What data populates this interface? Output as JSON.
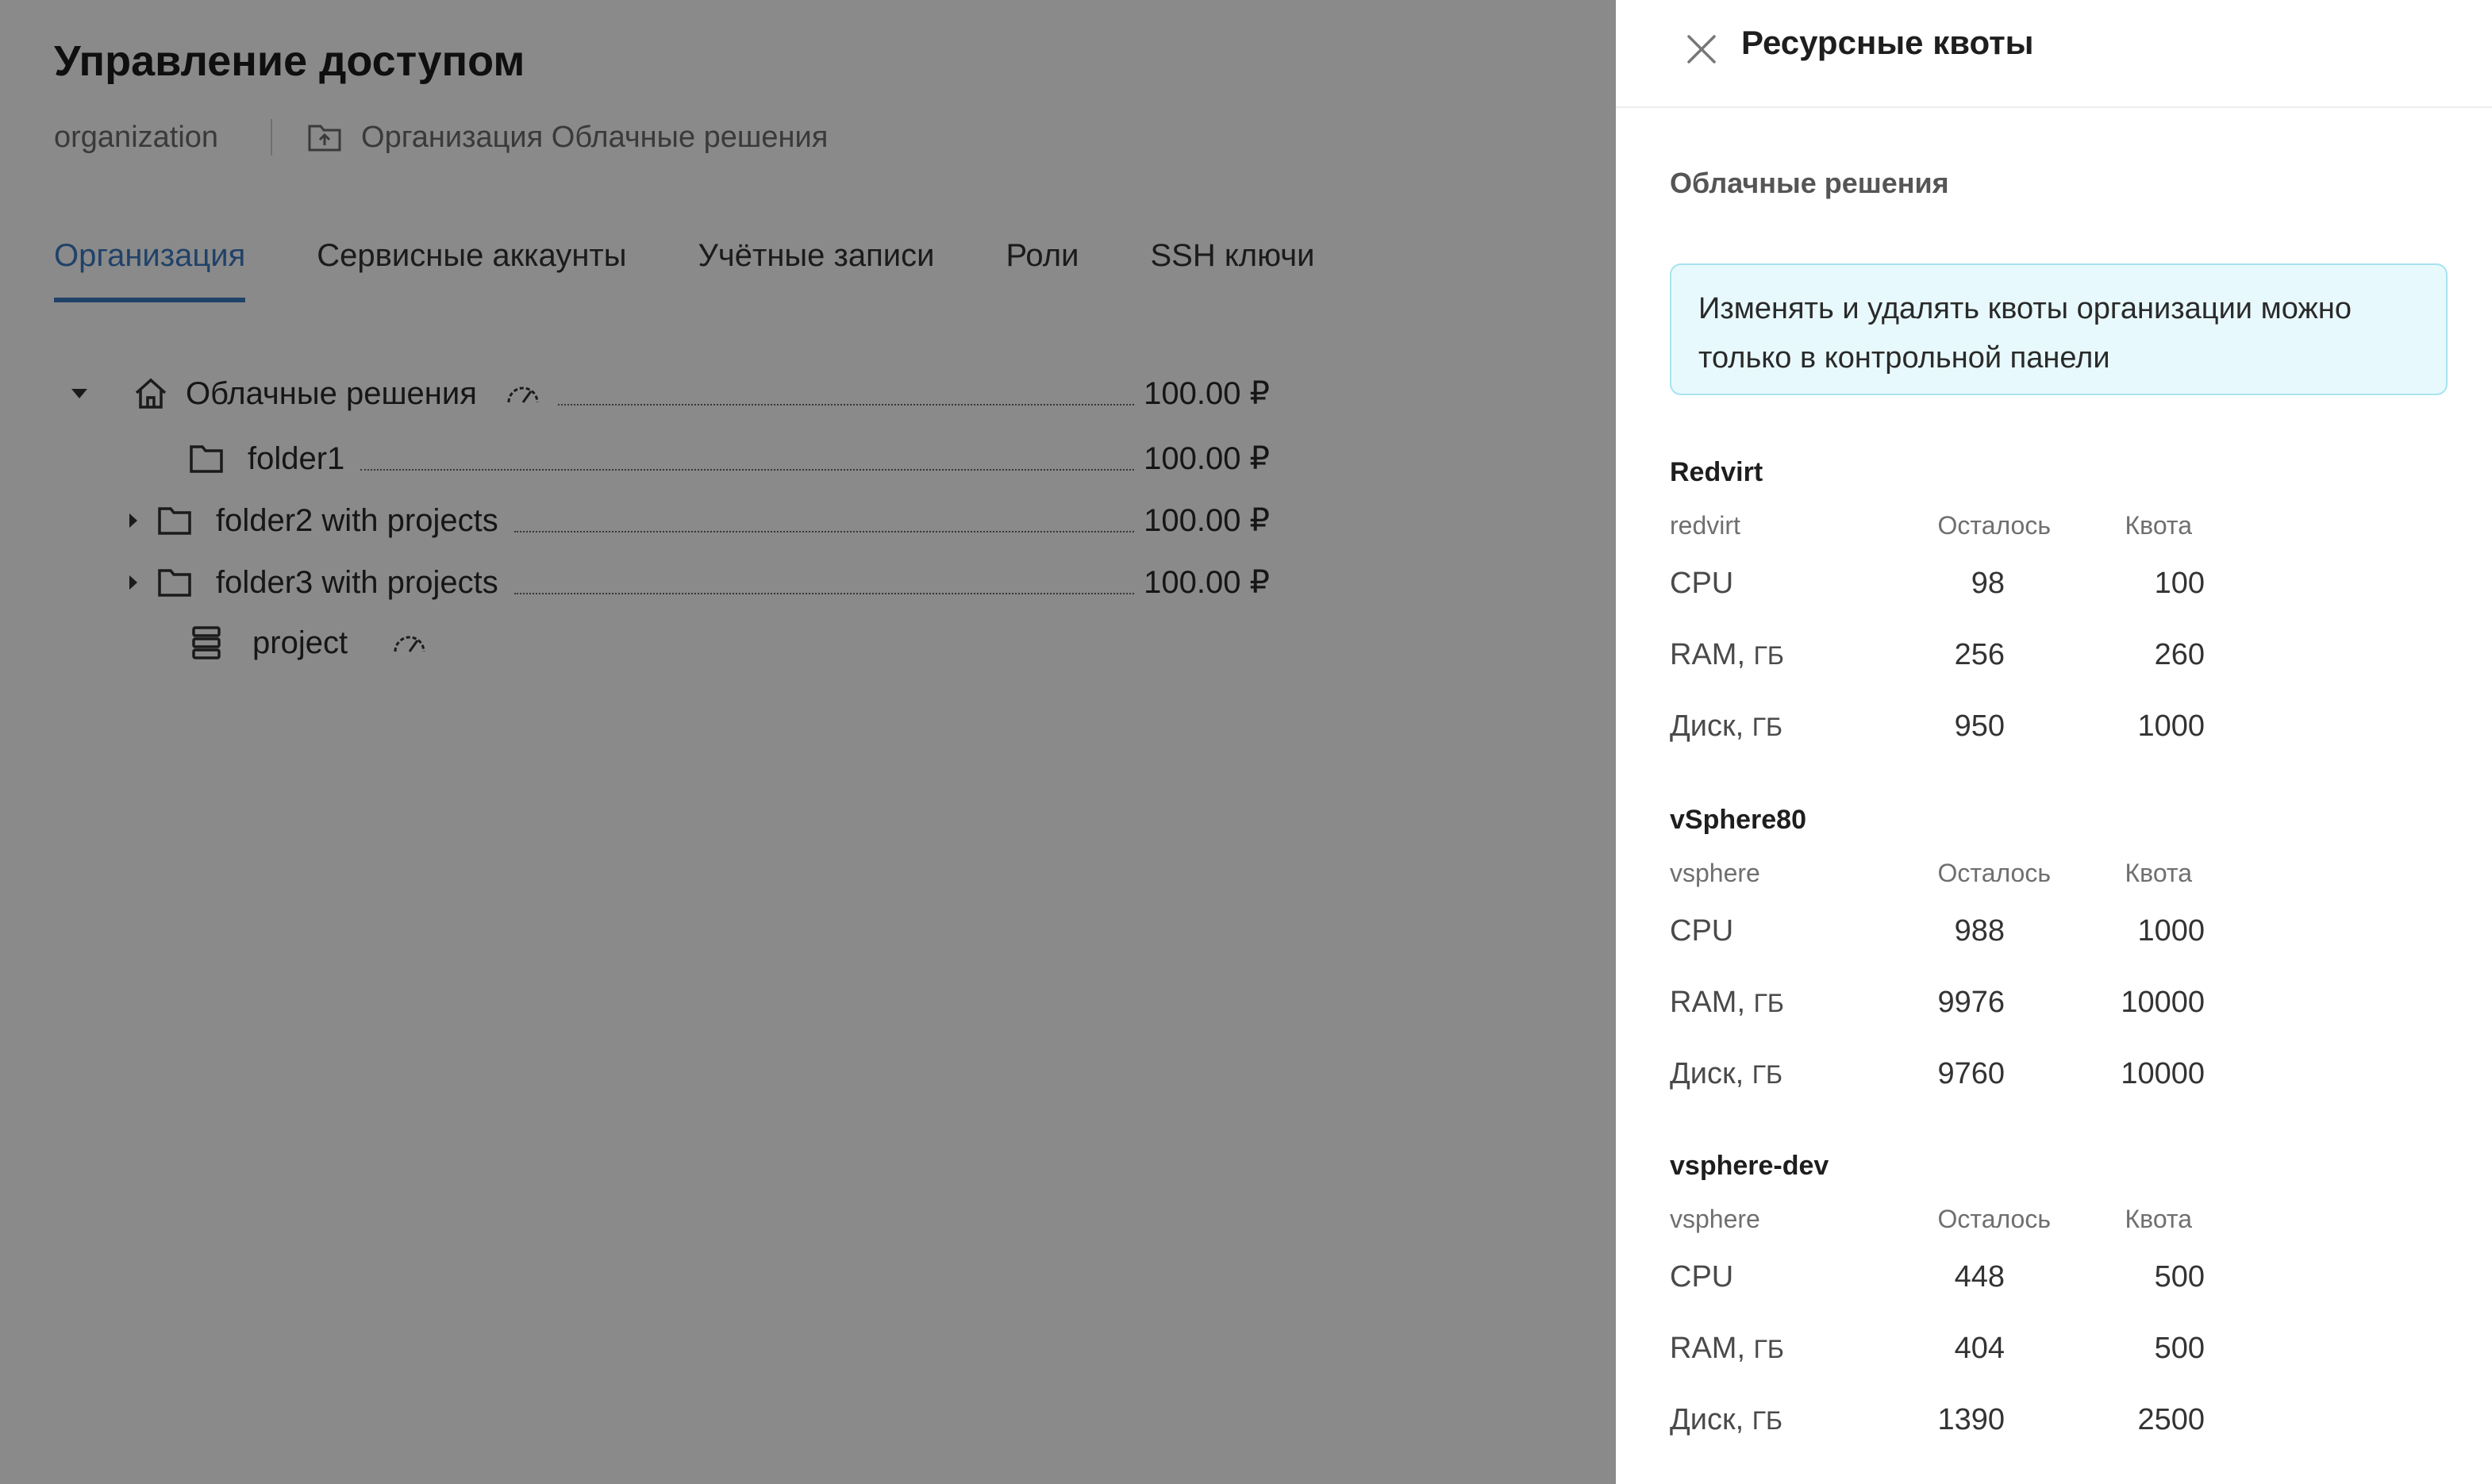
{
  "page": {
    "title": "Управление доступом",
    "breadcrumb": {
      "scope": "organization",
      "org": "Организация Облачные решения"
    },
    "tabs": [
      {
        "label": "Организация",
        "active": true
      },
      {
        "label": "Сервисные аккаунты"
      },
      {
        "label": "Учётные записи"
      },
      {
        "label": "Роли"
      },
      {
        "label": "SSH ключи"
      }
    ],
    "tree": [
      {
        "label": "Облачные решения",
        "icon": "home-icon",
        "caret": "expanded",
        "price": "100.00 ₽",
        "gauge": true
      },
      {
        "label": "folder1",
        "icon": "folder-icon",
        "caret": "none",
        "price": "100.00 ₽"
      },
      {
        "label": "folder2 with projects",
        "icon": "folder-icon",
        "caret": "collapsed",
        "price": "100.00 ₽"
      },
      {
        "label": "folder3 with projects",
        "icon": "folder-icon",
        "caret": "collapsed",
        "price": "100.00 ₽"
      },
      {
        "label": "project",
        "icon": "project-icon",
        "caret": "none",
        "gauge": true
      }
    ]
  },
  "drawer": {
    "title": "Ресурсные квоты",
    "section": "Облачные решения",
    "notice": "Изменять и удалять квоты организации можно только в контрольной панели",
    "groups": [
      {
        "name": "Redvirt",
        "type": "redvirt",
        "col_left": "Осталось",
        "col_quota": "Квота",
        "rows": [
          {
            "name": "CPU",
            "unit": "",
            "left": "98",
            "quota": "100"
          },
          {
            "name": "RAM, ",
            "unit": "ГБ",
            "left": "256",
            "quota": "260"
          },
          {
            "name": "Диск, ",
            "unit": "ГБ",
            "left": "950",
            "quota": "1000"
          }
        ]
      },
      {
        "name": "vSphere80",
        "type": "vsphere",
        "col_left": "Осталось",
        "col_quota": "Квота",
        "rows": [
          {
            "name": "CPU",
            "unit": "",
            "left": "988",
            "quota": "1000"
          },
          {
            "name": "RAM, ",
            "unit": "ГБ",
            "left": "9976",
            "quota": "10000"
          },
          {
            "name": "Диск, ",
            "unit": "ГБ",
            "left": "9760",
            "quota": "10000"
          }
        ]
      },
      {
        "name": "vsphere-dev",
        "type": "vsphere",
        "col_left": "Осталось",
        "col_quota": "Квота",
        "rows": [
          {
            "name": "CPU",
            "unit": "",
            "left": "448",
            "quota": "500"
          },
          {
            "name": "RAM, ",
            "unit": "ГБ",
            "left": "404",
            "quota": "500"
          },
          {
            "name": "Диск, ",
            "unit": "ГБ",
            "left": "1390",
            "quota": "2500"
          }
        ]
      }
    ]
  },
  "colors": {
    "accent": "#3b7bc2",
    "notice_bg": "#e8f9fd",
    "notice_border": "#a6e3f0",
    "overlay": "rgba(0,0,0,0.46)"
  }
}
